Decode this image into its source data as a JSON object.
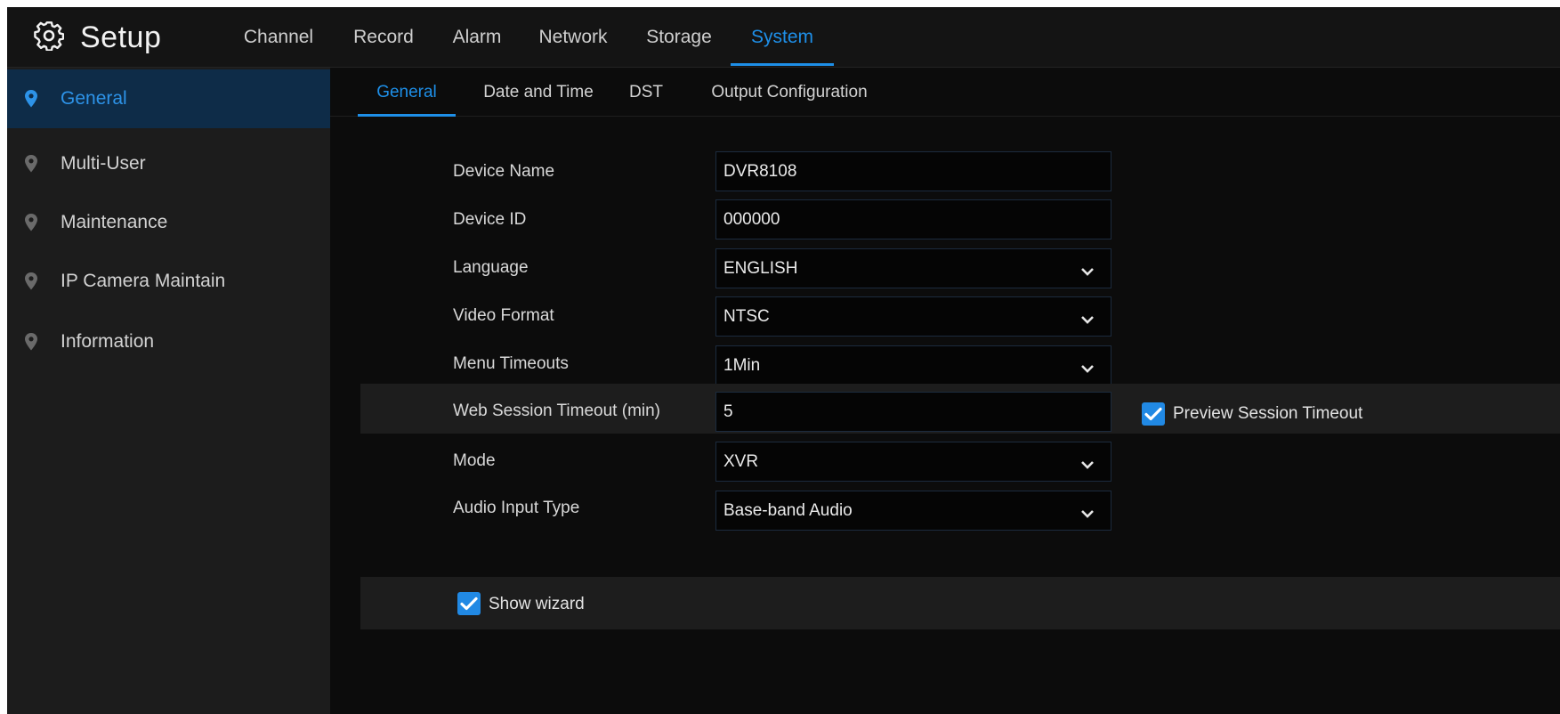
{
  "header": {
    "title": "Setup",
    "icon": "gear-icon",
    "tabs": [
      {
        "label": "Channel",
        "active": false
      },
      {
        "label": "Record",
        "active": false
      },
      {
        "label": "Alarm",
        "active": false
      },
      {
        "label": "Network",
        "active": false
      },
      {
        "label": "Storage",
        "active": false
      },
      {
        "label": "System",
        "active": true
      }
    ]
  },
  "sidebar": {
    "items": [
      {
        "label": "General",
        "active": true,
        "icon": "location-pin-icon"
      },
      {
        "label": "Multi-User",
        "active": false,
        "icon": "location-pin-icon"
      },
      {
        "label": "Maintenance",
        "active": false,
        "icon": "location-pin-icon"
      },
      {
        "label": "IP Camera Maintain",
        "active": false,
        "icon": "location-pin-icon"
      },
      {
        "label": "Information",
        "active": false,
        "icon": "location-pin-icon"
      }
    ]
  },
  "subtabs": [
    {
      "label": "General",
      "active": true
    },
    {
      "label": "Date and Time",
      "active": false
    },
    {
      "label": "DST",
      "active": false
    },
    {
      "label": "Output Configuration",
      "active": false
    }
  ],
  "form": {
    "device_name": {
      "label": "Device Name",
      "value": "DVR8108"
    },
    "device_id": {
      "label": "Device ID",
      "value": "000000"
    },
    "language": {
      "label": "Language",
      "value": "ENGLISH"
    },
    "video_format": {
      "label": "Video Format",
      "value": "NTSC"
    },
    "menu_timeouts": {
      "label": "Menu Timeouts",
      "value": "1Min"
    },
    "web_session_timeout": {
      "label": "Web Session Timeout (min)",
      "value": "5"
    },
    "preview_session_timeout": {
      "label": "Preview Session Timeout",
      "checked": true
    },
    "mode": {
      "label": "Mode",
      "value": "XVR"
    },
    "audio_input_type": {
      "label": "Audio Input Type",
      "value": "Base-band Audio"
    },
    "show_wizard": {
      "label": "Show wizard",
      "checked": true
    }
  },
  "colors": {
    "accent": "#1e8fe8",
    "sidebar_active_bg": "#0e2c48",
    "checkbox": "#2189e4"
  }
}
